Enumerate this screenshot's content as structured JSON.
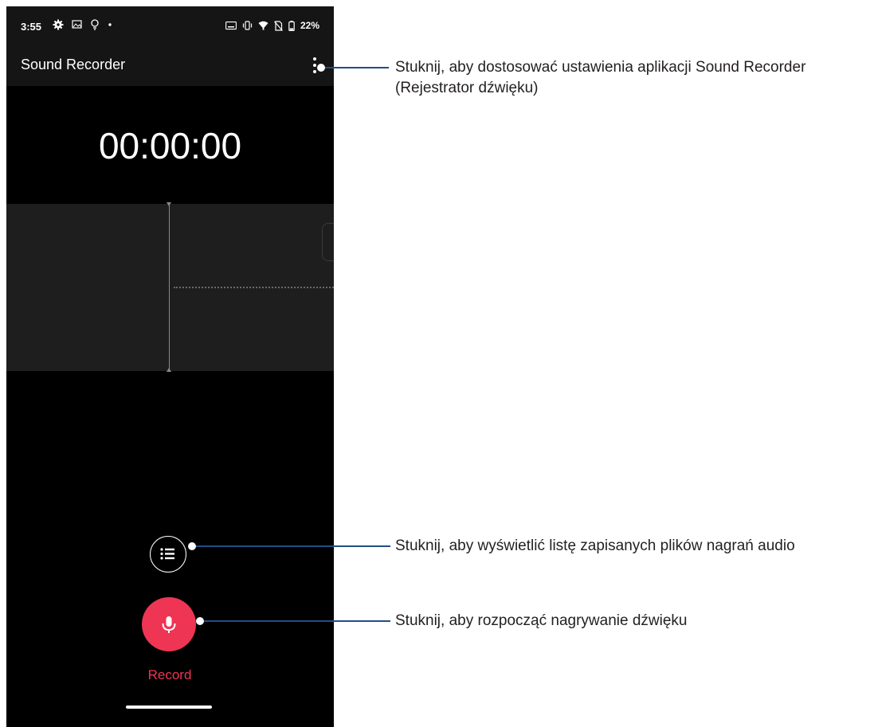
{
  "status_bar": {
    "time": "3:55",
    "battery": "22%"
  },
  "app": {
    "title": "Sound Recorder"
  },
  "recorder": {
    "timer": "00:00:00",
    "record_label": "Record"
  },
  "callouts": {
    "settings": "Stuknij, aby dostosować ustawienia aplikacji Sound Recorder (Rejestrator dźwięku)",
    "list": "Stuknij, aby wyświetlić listę zapisanych plików nagrań audio",
    "record": "Stuknij, aby rozpocząć nagrywanie dźwięku"
  },
  "colors": {
    "accent": "#ee3553",
    "callout_line": "#1f4e87",
    "background": "#000000"
  },
  "icons": [
    "settings-gear-icon",
    "gallery-icon",
    "bulb-icon",
    "keyboard-icon",
    "vibrate-icon",
    "wifi-icon",
    "no-sim-icon",
    "battery-icon",
    "more-vert-icon",
    "list-icon",
    "microphone-icon"
  ]
}
